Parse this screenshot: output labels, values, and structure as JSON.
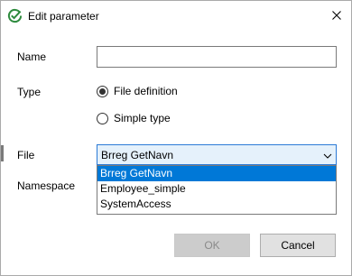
{
  "dialog": {
    "title": "Edit parameter",
    "close_icon": "close-icon",
    "app_icon": "checkmark-circle-icon"
  },
  "form": {
    "name_label": "Name",
    "name_value": "",
    "type_label": "Type",
    "type_options": [
      {
        "label": "File definition",
        "checked": true
      },
      {
        "label": "Simple type",
        "checked": false
      }
    ],
    "file_label": "File",
    "file_selected": "Brreg GetNavn",
    "file_options": [
      "Brreg GetNavn",
      "Employee_simple",
      "SystemAccess"
    ],
    "namespace_label": "Namespace"
  },
  "buttons": {
    "ok_label": "OK",
    "ok_enabled": false,
    "cancel_label": "Cancel"
  },
  "colors": {
    "accent": "#0078d7",
    "app_icon_green": "#2e8b3e",
    "select_focus_border": "#2b7ad6",
    "select_focus_bg": "#e5f1fb"
  }
}
